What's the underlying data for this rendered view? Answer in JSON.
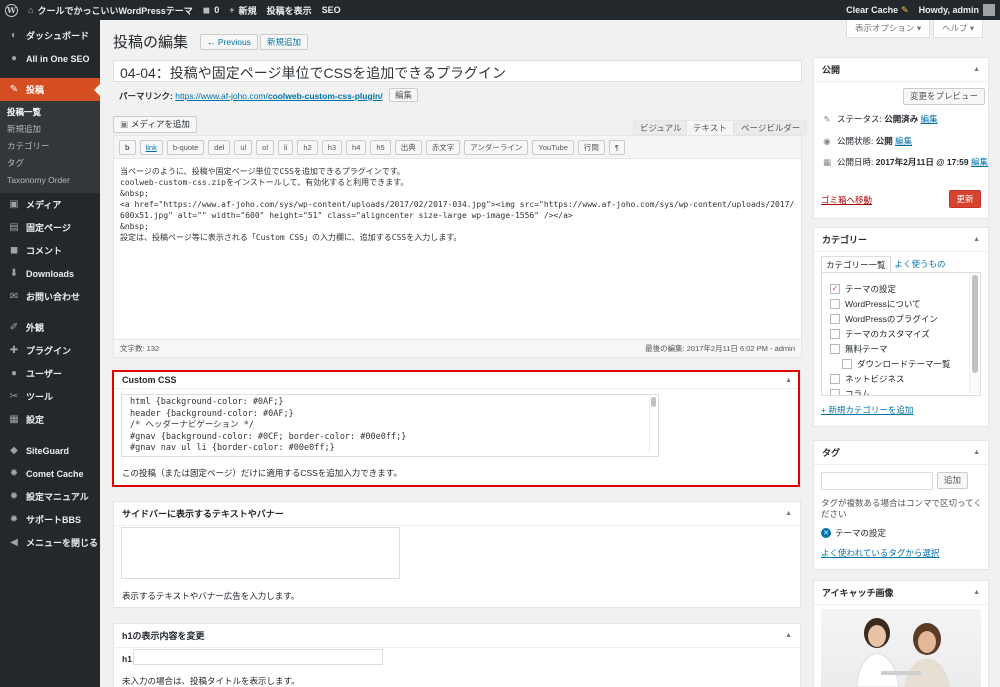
{
  "adminbar": {
    "site_name": "クールでかっこいいWordPressテーマ",
    "comments_count": "0",
    "new_label": "新規",
    "view_post": "投稿を表示",
    "seo": "SEO",
    "clear_cache": "Clear Cache",
    "howdy": "Howdy, admin"
  },
  "sidebar": {
    "items": [
      {
        "label": "ダッシュボード",
        "icon": "dashboard-icon",
        "glyph": "◐"
      },
      {
        "label": "All in One SEO",
        "icon": "seo-icon",
        "glyph": "●"
      },
      {
        "label": "投稿",
        "icon": "pin-icon",
        "glyph": "✎"
      },
      {
        "label": "メディア",
        "icon": "media-icon",
        "glyph": "▣"
      },
      {
        "label": "固定ページ",
        "icon": "page-icon",
        "glyph": "▤"
      },
      {
        "label": "コメント",
        "icon": "comment-icon",
        "glyph": "◼"
      },
      {
        "label": "Downloads",
        "icon": "download-icon",
        "glyph": "⬇"
      },
      {
        "label": "お問い合わせ",
        "icon": "mail-icon",
        "glyph": "✉"
      },
      {
        "label": "外観",
        "icon": "appearance-icon",
        "glyph": "✐"
      },
      {
        "label": "プラグイン",
        "icon": "plugin-icon",
        "glyph": "✚"
      },
      {
        "label": "ユーザー",
        "icon": "user-icon",
        "glyph": "●"
      },
      {
        "label": "ツール",
        "icon": "tool-icon",
        "glyph": "✂"
      },
      {
        "label": "設定",
        "icon": "settings-icon",
        "glyph": "▦"
      },
      {
        "label": "SiteGuard",
        "icon": "shield-icon",
        "glyph": "◆"
      },
      {
        "label": "Comet Cache",
        "icon": "gear-icon",
        "glyph": "✹"
      },
      {
        "label": "設定マニュアル",
        "icon": "gear-icon",
        "glyph": "✹"
      },
      {
        "label": "サポートBBS",
        "icon": "gear-icon",
        "glyph": "✹"
      },
      {
        "label": "メニューを閉じる",
        "icon": "collapse-icon",
        "glyph": "◀"
      }
    ],
    "submenu": [
      "投稿一覧",
      "新規追加",
      "カテゴリー",
      "タグ",
      "Taxonomy Order"
    ]
  },
  "header": {
    "title": "投稿の編集",
    "previous": "← Previous",
    "add_new": "新規追加",
    "screen_options": "表示オプション ▾",
    "help": "ヘルプ ▾"
  },
  "post": {
    "title": "04-04：投稿や固定ページ単位でCSSを追加できるプラグイン",
    "permalink_label": "パーマリンク:",
    "permalink_base": "https://www.af-joho.com/",
    "permalink_slug": "coolweb-custom-css-plugin/",
    "permalink_edit": "編集"
  },
  "editor": {
    "add_media": "メディアを追加",
    "tabs": [
      "ビジュアル",
      "テキスト",
      "ページビルダー"
    ],
    "quicktags": [
      "b",
      "link",
      "b-quote",
      "del",
      "ul",
      "ol",
      "li",
      "h2",
      "h3",
      "h4",
      "h5",
      "出典",
      "赤文字",
      "アンダーライン",
      "YouTube",
      "行間",
      "¶"
    ],
    "content": [
      "当ページのように、投稿や固定ページ単位でCSSを追加できるプラグインです。",
      "coolweb-custom-css.zipをインストールして、有効化すると利用できます。",
      "&nbsp;",
      "<a href=\"https://www.af-joho.com/sys/wp-content/uploads/2017/02/2017-034.jpg\"><img src=\"https://www.af-joho.com/sys/wp-content/uploads/2017/02/2017-034-",
      "600x51.jpg\" alt=\"\" width=\"600\" height=\"51\" class=\"aligncenter size-large wp-image-1556\" /></a>",
      "&nbsp;",
      "設定は、投稿ページ等に表示される「Custom CSS」の入力欄に、追加するCSSを入力します。"
    ],
    "word_count": "文字数: 132",
    "last_edited": "最後の編集: 2017年2月11日 6:02 PM - admin"
  },
  "custom_css": {
    "heading": "Custom CSS",
    "lines": [
      "html  {background-color: #0AF;}",
      "header {background-color: #0AF;}",
      "/*  ヘッダーナビゲーション  */",
      "#gnav {background-color: #0CF; border-color: #00e0ff;}",
      "#gnav nav ul li {border-color: #00e0ff;}"
    ],
    "note": "この投稿（または固定ページ）だけに適用するCSSを追加入力できます。"
  },
  "sidebar_text": {
    "heading": "サイドバーに表示するテキストやバナー",
    "note": "表示するテキストやバナー広告を入力します。"
  },
  "h1_box": {
    "heading": "h1の表示内容を変更",
    "label": "h1",
    "note": "未入力の場合は、投稿タイトルを表示します。"
  },
  "publish": {
    "heading": "公開",
    "preview": "変更をプレビュー",
    "status_label": "ステータス:",
    "status_value": "公開済み",
    "visibility_label": "公開状態:",
    "visibility_value": "公開",
    "date_label": "公開日時:",
    "date_value": "2017年2月11日 @ 17:59",
    "edit": "編集",
    "trash": "ゴミ箱へ移動",
    "update": "更新"
  },
  "categories": {
    "heading": "カテゴリー",
    "tab_all": "カテゴリー一覧",
    "tab_popular": "よく使うもの",
    "items": [
      {
        "label": "テーマの設定",
        "checked": true,
        "child": false
      },
      {
        "label": "WordPressについて",
        "checked": false,
        "child": false
      },
      {
        "label": "WordPressのプラグイン",
        "checked": false,
        "child": false
      },
      {
        "label": "テーマのカスタマイズ",
        "checked": false,
        "child": false
      },
      {
        "label": "無料テーマ",
        "checked": false,
        "child": false
      },
      {
        "label": "ダウンロードテーマ一覧",
        "checked": false,
        "child": true
      },
      {
        "label": "ネットビジネス",
        "checked": false,
        "child": false
      },
      {
        "label": "コラム",
        "checked": false,
        "child": false
      }
    ],
    "add_new": "+ 新規カテゴリーを追加"
  },
  "tags": {
    "heading": "タグ",
    "add": "追加",
    "hint": "タグが複数ある場合はコンマで区切ってください",
    "tag": "テーマの設定",
    "choose": "よく使われているタグから選択"
  },
  "featured": {
    "heading": "アイキャッチ画像"
  },
  "colors": {
    "accent": "#d54e21",
    "link": "#0073aa",
    "highlight_frame": "#e00000",
    "admin_bg": "#23282d"
  }
}
